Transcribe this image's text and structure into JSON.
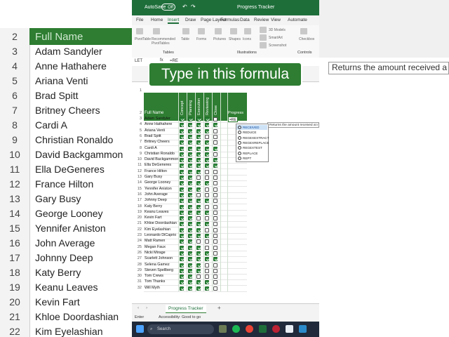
{
  "background": {
    "header": "Full Name",
    "row_numbers": [
      "2",
      "3",
      "4",
      "5",
      "6",
      "7",
      "8",
      "9",
      "10",
      "11",
      "12",
      "13",
      "14",
      "15",
      "16",
      "17",
      "18",
      "19",
      "20",
      "21",
      "22"
    ],
    "names": [
      "Adam Sandyler",
      "Anne Hathahere",
      "Ariana Venti",
      "Brad Spitt",
      "Britney Cheers",
      "Cardi A",
      "Christian Ronaldo",
      "David Backgammon",
      "Ella DeGeneres",
      "France Hilton",
      "Gary Busy",
      "George Looney",
      "Yennifer Aniston",
      "John Average",
      "Johnny Deep",
      "Katy Berry",
      "Keanu Leaves",
      "Kevin Fart",
      "Khloe Doordashian",
      "Kim Eyelashian"
    ],
    "tooltip": "Returns the amount received a"
  },
  "titlebar": {
    "autosave": "AutoSave",
    "toggle": "Off",
    "title": "Progress Tracker"
  },
  "tabs": [
    "File",
    "Home",
    "Insert",
    "Draw",
    "Page Layout",
    "Formulas",
    "Data",
    "Review",
    "View",
    "Automate"
  ],
  "active_tab": "Insert",
  "ribbon": {
    "items": [
      "PivotTable",
      "Recommended PivotTables",
      "Table",
      "Forms",
      "Pictures",
      "Shapes",
      "Icons",
      "3D Models",
      "SmartArt",
      "Screenshot",
      "Checkbox"
    ],
    "groups": [
      "Tables",
      "Illustrations",
      "Controls"
    ]
  },
  "formula_bar": {
    "name_box": "LET",
    "formula": "=RE"
  },
  "callout": "Type in this formula",
  "sheet": {
    "col_headers": [
      "Full Name",
      "Concept",
      "Planning",
      "Execution",
      "Reviewing",
      "Close",
      "Progress"
    ],
    "rows": [
      {
        "num": "3",
        "name": "Adam Sandyler",
        "c": [
          1,
          1,
          1,
          1,
          0
        ]
      },
      {
        "num": "4",
        "name": "Anne Hathahere",
        "c": [
          1,
          1,
          1,
          1,
          1
        ]
      },
      {
        "num": "5",
        "name": "Ariana Venti",
        "c": [
          1,
          1,
          1,
          1,
          0
        ]
      },
      {
        "num": "6",
        "name": "Brad Spitt",
        "c": [
          1,
          1,
          1,
          0,
          0
        ]
      },
      {
        "num": "7",
        "name": "Britney Cheers",
        "c": [
          1,
          1,
          1,
          1,
          0
        ]
      },
      {
        "num": "8",
        "name": "Cardi A",
        "c": [
          1,
          1,
          1,
          1,
          1
        ]
      },
      {
        "num": "9",
        "name": "Christian Ronaldo",
        "c": [
          1,
          1,
          1,
          1,
          0
        ]
      },
      {
        "num": "10",
        "name": "David Backgammon",
        "c": [
          1,
          1,
          1,
          1,
          1
        ]
      },
      {
        "num": "11",
        "name": "Ella DeGeneres",
        "c": [
          1,
          1,
          1,
          1,
          1
        ]
      },
      {
        "num": "12",
        "name": "France Hilton",
        "c": [
          1,
          1,
          1,
          0,
          0
        ]
      },
      {
        "num": "13",
        "name": "Gary Busy",
        "c": [
          1,
          1,
          0,
          0,
          0
        ]
      },
      {
        "num": "14",
        "name": "George Looney",
        "c": [
          1,
          1,
          1,
          1,
          0
        ]
      },
      {
        "num": "15",
        "name": "Yennifer Aniston",
        "c": [
          1,
          1,
          1,
          0,
          0
        ]
      },
      {
        "num": "16",
        "name": "John Average",
        "c": [
          1,
          1,
          0,
          0,
          0
        ]
      },
      {
        "num": "17",
        "name": "Johnny Deep",
        "c": [
          1,
          1,
          1,
          1,
          0
        ]
      },
      {
        "num": "18",
        "name": "Katy Berry",
        "c": [
          1,
          1,
          1,
          0,
          0
        ]
      },
      {
        "num": "19",
        "name": "Keanu Leaves",
        "c": [
          1,
          1,
          1,
          1,
          0
        ]
      },
      {
        "num": "20",
        "name": "Kevin Fart",
        "c": [
          1,
          1,
          0,
          0,
          0
        ]
      },
      {
        "num": "21",
        "name": "Khloe Doordashian",
        "c": [
          1,
          1,
          1,
          1,
          0
        ]
      },
      {
        "num": "22",
        "name": "Kim Eyelashian",
        "c": [
          1,
          1,
          1,
          0,
          0
        ]
      },
      {
        "num": "23",
        "name": "Leonardo DiCaprio",
        "c": [
          1,
          1,
          1,
          1,
          0
        ]
      },
      {
        "num": "24",
        "name": "Matt Ramen",
        "c": [
          1,
          1,
          0,
          0,
          0
        ]
      },
      {
        "num": "25",
        "name": "Megan Faux",
        "c": [
          1,
          1,
          1,
          0,
          0
        ]
      },
      {
        "num": "26",
        "name": "Nicki Mirage",
        "c": [
          1,
          1,
          1,
          1,
          0
        ]
      },
      {
        "num": "27",
        "name": "Scarlett Johnson",
        "c": [
          1,
          1,
          1,
          1,
          1
        ]
      },
      {
        "num": "28",
        "name": "Selena Gamez",
        "c": [
          1,
          1,
          1,
          0,
          0
        ]
      },
      {
        "num": "29",
        "name": "Steven Spellberg",
        "c": [
          1,
          1,
          1,
          0,
          0
        ]
      },
      {
        "num": "30",
        "name": "Tom Crews",
        "c": [
          1,
          1,
          0,
          0,
          0
        ]
      },
      {
        "num": "31",
        "name": "Tom Thanks",
        "c": [
          1,
          1,
          1,
          1,
          0
        ]
      },
      {
        "num": "32",
        "name": "Will Myth",
        "c": [
          1,
          1,
          1,
          1,
          0
        ]
      }
    ]
  },
  "autocomplete": [
    "RECEIVED",
    "REDUCE",
    "REGEXEXTRACT",
    "REGEXREPLACE",
    "REGEXTEST",
    "REPLACE",
    "REPT"
  ],
  "function_tooltip": "Returns the amount received at maturity",
  "sheet_tab": "Progress Tracker",
  "status": {
    "mode": "Enter",
    "accessibility": "Accessibility: Good to go"
  },
  "taskbar": {
    "search": "Search"
  },
  "colors": {
    "excel_green": "#1e6e3a",
    "header_green": "#2e7d32",
    "checkbox_green": "#2f8a3c"
  }
}
